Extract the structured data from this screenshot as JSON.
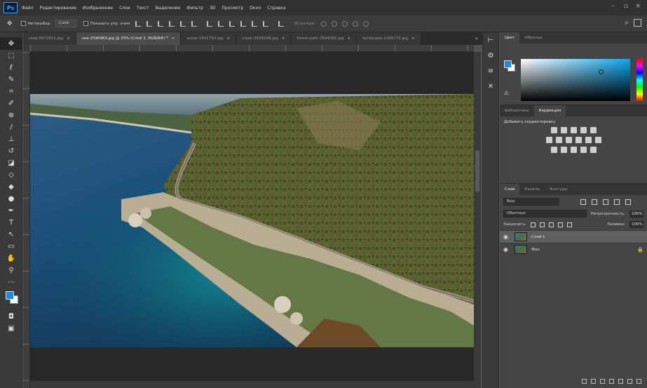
{
  "app": {
    "logo": "Ps",
    "menu": [
      "Файл",
      "Редактирование",
      "Изображение",
      "Слои",
      "Текст",
      "Выделение",
      "Фильтр",
      "3D",
      "Просмотр",
      "Окно",
      "Справка"
    ]
  },
  "options": {
    "autoselect_label": "Автовыбор:",
    "autoselect_value": "Слой",
    "show_controls_label": "Показать упр. элем.",
    "mode_3d_label": "3D-режим:"
  },
  "tabs": [
    {
      "label": "road-5672821.jpg",
      "active": false
    },
    {
      "label": "sea-2596963.jpg @ 25% (Слой 1, RGB/8#) *",
      "active": true
    },
    {
      "label": "water-1641793.jpg",
      "active": false
    },
    {
      "label": "creek-2639249.jpg",
      "active": false
    },
    {
      "label": "forest-path-2644082.jpg",
      "active": false
    },
    {
      "label": "landscape-2268775.jpg",
      "active": false
    }
  ],
  "tab_close_glyph": "×",
  "tab_overflow_glyph": "»",
  "panels": {
    "color_tabs": [
      "Цвет",
      "Образцы"
    ],
    "adj_tabs": [
      "Библиотеки",
      "Коррекция"
    ],
    "adj_title": "Добавить корректировку",
    "layers_tabs": [
      "Слои",
      "Каналы",
      "Контуры"
    ],
    "kind_select": "Вид",
    "blend_mode": "Обычные",
    "opacity_label": "Непрозрачность:",
    "opacity_value": "100%",
    "lock_label": "Закрепить:",
    "fill_label": "Заливка:",
    "fill_value": "100%",
    "layers": [
      {
        "name": "Слой 1",
        "selected": true,
        "locked": false
      },
      {
        "name": "Фон",
        "selected": false,
        "locked": true
      }
    ]
  },
  "colors": {
    "foreground": "#1f8ad8",
    "background": "#ffffff"
  }
}
